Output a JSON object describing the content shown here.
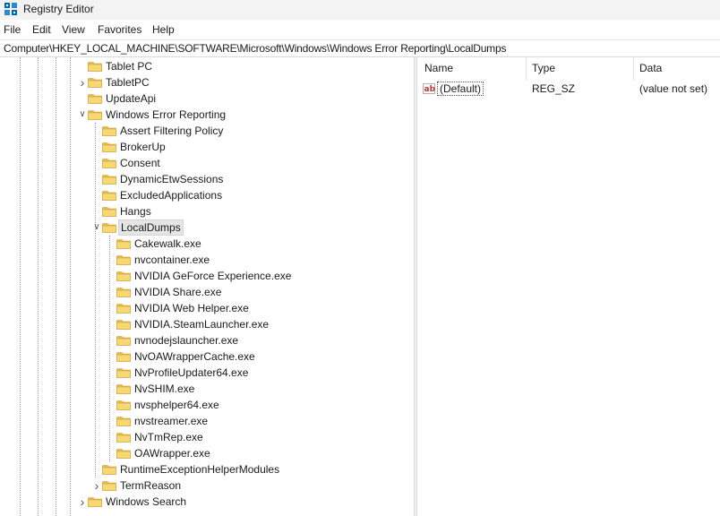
{
  "window": {
    "title": "Registry Editor",
    "icon": "registry-editor-icon"
  },
  "menu": [
    "File",
    "Edit",
    "View",
    "Favorites",
    "Help"
  ],
  "address": "Computer\\HKEY_LOCAL_MACHINE\\SOFTWARE\\Microsoft\\Windows\\Windows Error Reporting\\LocalDumps",
  "tree": [
    {
      "label": "Tablet PC",
      "expander": ""
    },
    {
      "label": "TabletPC",
      "expander": "collapsed"
    },
    {
      "label": "UpdateApi",
      "expander": ""
    },
    {
      "label": "Windows Error Reporting",
      "expander": "expanded"
    },
    {
      "label": "Assert Filtering Policy",
      "expander": ""
    },
    {
      "label": "BrokerUp",
      "expander": ""
    },
    {
      "label": "Consent",
      "expander": ""
    },
    {
      "label": "DynamicEtwSessions",
      "expander": ""
    },
    {
      "label": "ExcludedApplications",
      "expander": ""
    },
    {
      "label": "Hangs",
      "expander": ""
    },
    {
      "label": "LocalDumps",
      "expander": "expanded",
      "selected": true
    },
    {
      "label": "Cakewalk.exe",
      "expander": ""
    },
    {
      "label": "nvcontainer.exe",
      "expander": ""
    },
    {
      "label": "NVIDIA GeForce Experience.exe",
      "expander": ""
    },
    {
      "label": "NVIDIA Share.exe",
      "expander": ""
    },
    {
      "label": "NVIDIA Web Helper.exe",
      "expander": ""
    },
    {
      "label": "NVIDIA.SteamLauncher.exe",
      "expander": ""
    },
    {
      "label": "nvnodejslauncher.exe",
      "expander": ""
    },
    {
      "label": "NvOAWrapperCache.exe",
      "expander": ""
    },
    {
      "label": "NvProfileUpdater64.exe",
      "expander": ""
    },
    {
      "label": "NvSHIM.exe",
      "expander": ""
    },
    {
      "label": "nvsphelper64.exe",
      "expander": ""
    },
    {
      "label": "nvstreamer.exe",
      "expander": ""
    },
    {
      "label": "NvTmRep.exe",
      "expander": ""
    },
    {
      "label": "OAWrapper.exe",
      "expander": ""
    },
    {
      "label": "RuntimeExceptionHelperModules",
      "expander": ""
    },
    {
      "label": "TermReason",
      "expander": "collapsed"
    },
    {
      "label": "Windows Search",
      "expander": "collapsed"
    }
  ],
  "list": {
    "columns": [
      "Name",
      "Type",
      "Data"
    ],
    "rows": [
      {
        "name": "(Default)",
        "type": "REG_SZ",
        "data": "(value not set)",
        "icon": "string-value-icon"
      }
    ]
  },
  "colors": {
    "folder": "#f8d775",
    "folder_dark": "#e8b84a",
    "selection": "#e5e5e5",
    "icon_blue": "#0067c0"
  }
}
